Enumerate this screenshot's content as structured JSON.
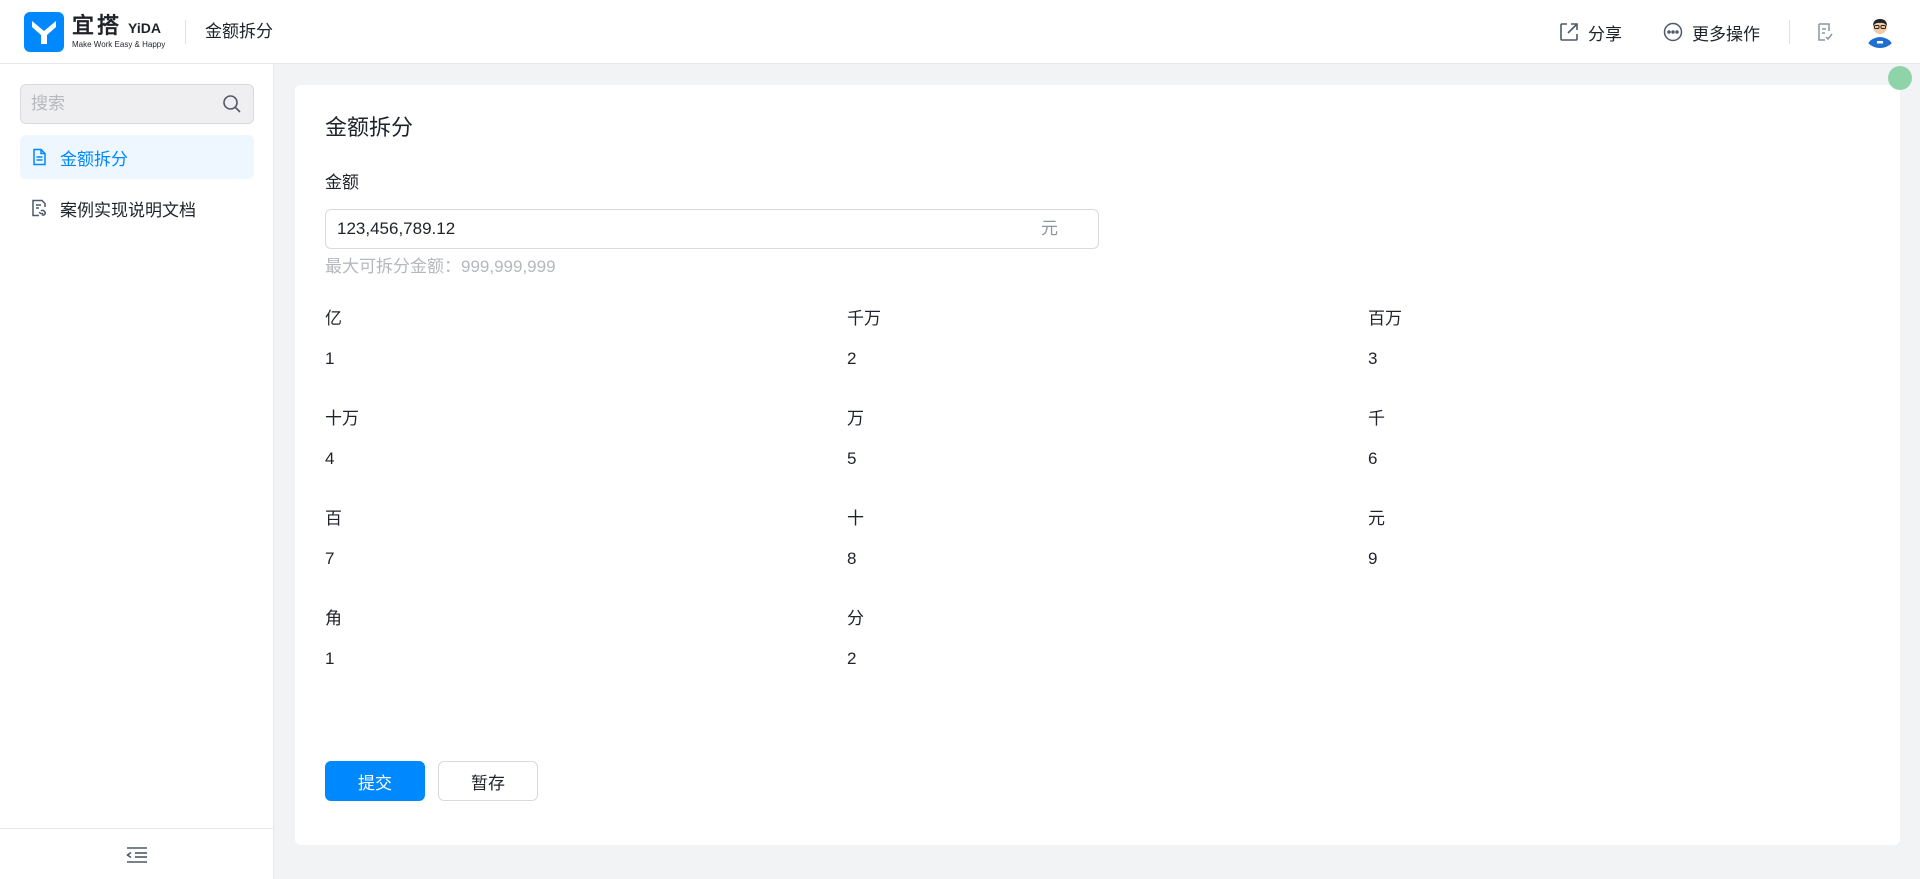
{
  "header": {
    "logo_cn": "宜搭",
    "logo_en": "YiDA",
    "logo_slogan": "Make Work Easy & Happy",
    "app_title": "金额拆分",
    "share_label": "分享",
    "more_label": "更多操作",
    "brand_color": "#0089ff"
  },
  "sidebar": {
    "search_placeholder": "搜索",
    "items": [
      {
        "label": "金额拆分",
        "icon": "file-icon",
        "active": true
      },
      {
        "label": "案例实现说明文档",
        "icon": "doc-link-icon",
        "active": false
      }
    ]
  },
  "form": {
    "title": "金额拆分",
    "amount_label": "金额",
    "amount_value": "123,456,789.12",
    "amount_unit": "元",
    "amount_hint": "最大可拆分金额：999,999,999",
    "fields": [
      {
        "label": "亿",
        "value": "1"
      },
      {
        "label": "千万",
        "value": "2"
      },
      {
        "label": "百万",
        "value": "3"
      },
      {
        "label": "十万",
        "value": "4"
      },
      {
        "label": "万",
        "value": "5"
      },
      {
        "label": "千",
        "value": "6"
      },
      {
        "label": "百",
        "value": "7"
      },
      {
        "label": "十",
        "value": "8"
      },
      {
        "label": "元",
        "value": "9"
      },
      {
        "label": "角",
        "value": "1"
      },
      {
        "label": "分",
        "value": "2"
      }
    ],
    "submit_label": "提交",
    "save_label": "暂存"
  }
}
